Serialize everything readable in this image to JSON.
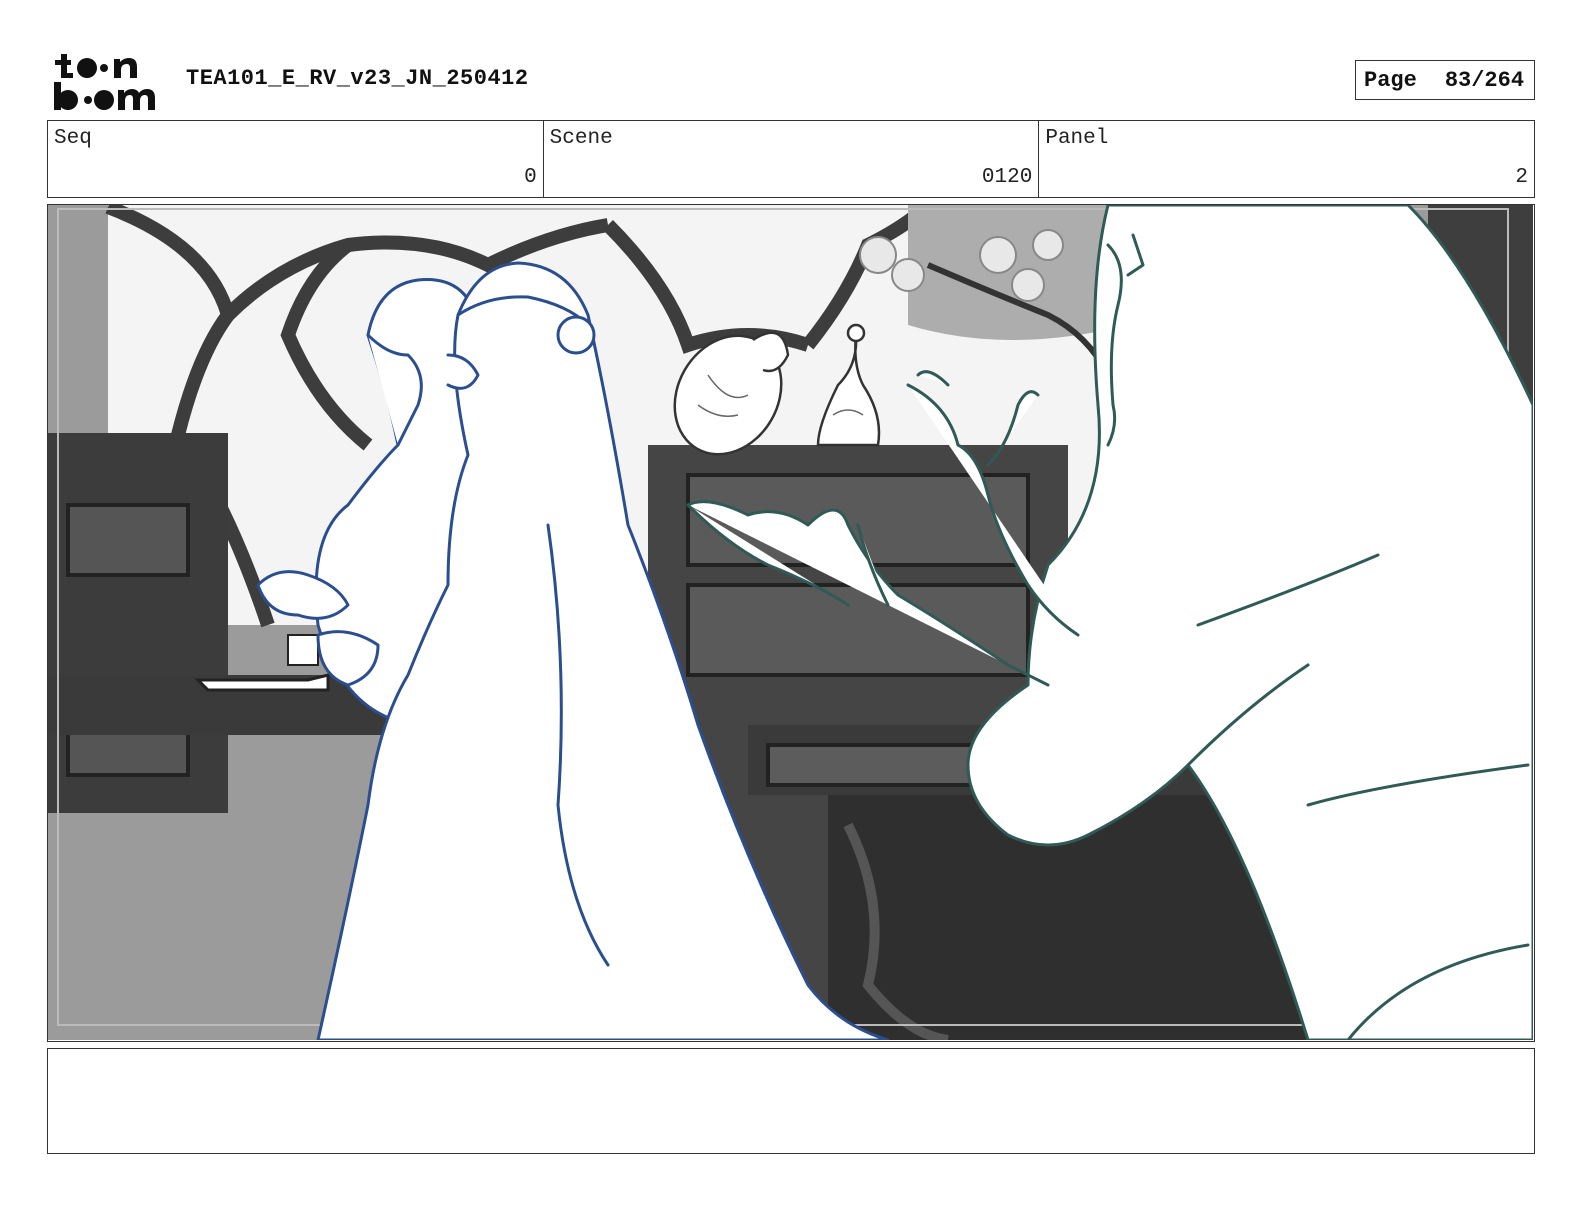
{
  "header": {
    "logo_text": "toon boom",
    "title": "TEA101_E_RV_v23_JN_250412",
    "page_label": "Page",
    "page_number": "83/264"
  },
  "info": {
    "seq_label": "Seq",
    "seq_value": "0",
    "scene_label": "Scene",
    "scene_value": "0120",
    "panel_label": "Panel",
    "panel_value": "2"
  },
  "panel_image": {
    "icon": "storyboard-sketch",
    "colors": {
      "character_line": "#2a4e8e",
      "character_line_2": "#2f5a55",
      "background_dark": "#3a3a3a",
      "background_mid": "#8a8a8a"
    }
  },
  "notes": {
    "text": ""
  }
}
